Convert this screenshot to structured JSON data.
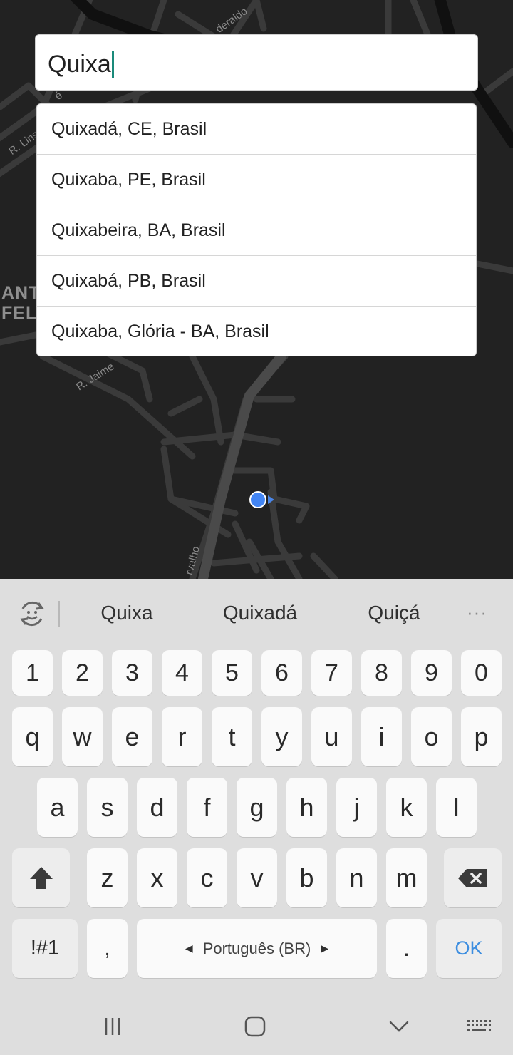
{
  "map": {
    "street_labels": [
      "R. Lins",
      "é",
      "deraldo",
      "R. Jaime",
      "rvalho"
    ],
    "area_label_lines": [
      "ANTO",
      "FELI"
    ],
    "colors": {
      "background": "#222222",
      "road": "#3c3c3c",
      "major_road": "#111111",
      "location": "#4285f4"
    }
  },
  "search": {
    "value": "Quixa",
    "cursor_color": "#1a8a7a"
  },
  "suggestions": [
    "Quixadá, CE, Brasil",
    "Quixaba, PE, Brasil",
    "Quixabeira, BA, Brasil",
    "Quixabá, PB, Brasil",
    "Quixaba, Glória - BA, Brasil"
  ],
  "keyboard": {
    "predictions": [
      "Quixa",
      "Quixadá",
      "Quiçá"
    ],
    "more_label": "···",
    "number_row": [
      "1",
      "2",
      "3",
      "4",
      "5",
      "6",
      "7",
      "8",
      "9",
      "0"
    ],
    "row1": [
      "q",
      "w",
      "e",
      "r",
      "t",
      "y",
      "u",
      "i",
      "o",
      "p"
    ],
    "row2": [
      "a",
      "s",
      "d",
      "f",
      "g",
      "h",
      "j",
      "k",
      "l"
    ],
    "row3": [
      "z",
      "x",
      "c",
      "v",
      "b",
      "n",
      "m"
    ],
    "symbols_label": "!#1",
    "comma_label": ",",
    "language_label": "Português (BR)",
    "period_label": ".",
    "ok_label": "OK",
    "icons": {
      "shift": "shift-arrow-icon",
      "backspace": "backspace-icon",
      "predictive": "predictive-text-icon"
    },
    "accent_color": "#3d8ee0"
  },
  "navbar": {
    "icons": [
      "recent-apps-icon",
      "home-icon",
      "back-icon",
      "keyboard-icon"
    ]
  }
}
